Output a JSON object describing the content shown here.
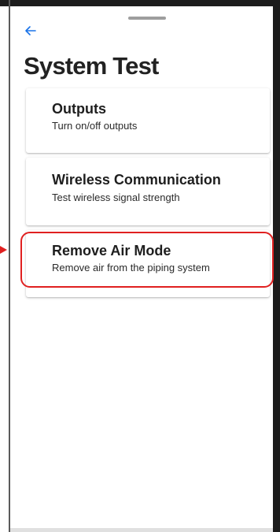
{
  "header": {
    "back_icon": "arrow-left-icon",
    "title": "System Test"
  },
  "menu": {
    "items": [
      {
        "title": "Outputs",
        "subtitle": "Turn on/off outputs"
      },
      {
        "title": "Wireless Communication",
        "subtitle": "Test wireless signal strength"
      },
      {
        "title": "Remove Air Mode",
        "subtitle": "Remove air from the piping system",
        "highlighted": true
      }
    ]
  },
  "colors": {
    "accent": "#1a73e8",
    "highlight": "#e02020",
    "title_text": "#222222"
  }
}
